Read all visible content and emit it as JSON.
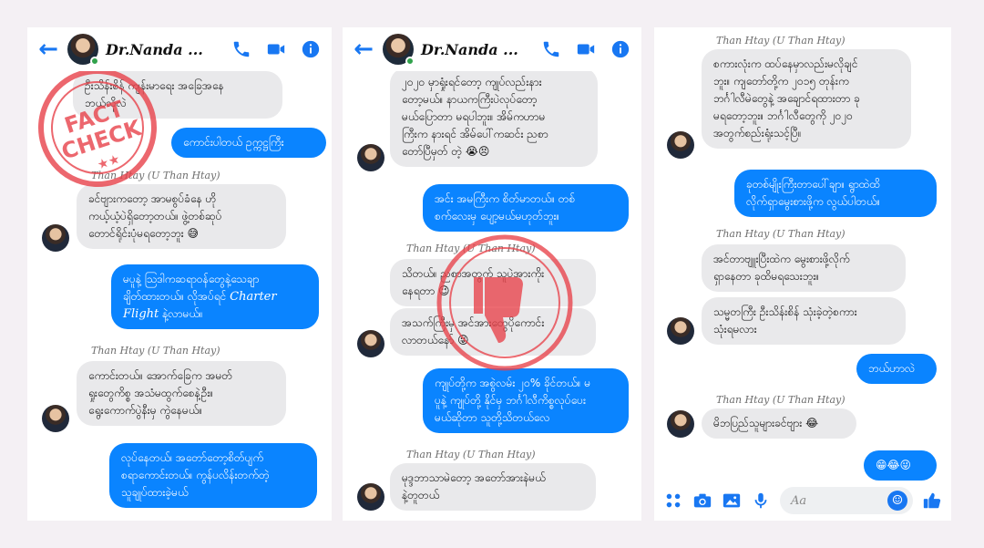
{
  "panel1": {
    "header": {
      "name": "Dr.Nanda ..."
    },
    "m1": "ဦးသိန်းစိန် ကျန်းမာရေး အခြေအနေ\nဘယ်လိုလဲ",
    "m2": "ကောင်းပါတယ် ဥက္ကဋ္ဌကြီး",
    "s1": "Than Htay (U Than Htay)",
    "m3": "ခင်ဗျားကတော့ အာမစွပ်ခံနေ ဟို\nကယ့်ယံ့ပဲရှိတော့တယ်။ ဖွဲ့တစ်ဆုပ်\nတောင်ရိုင်းပုံမရတော့ဘူး 😅",
    "m4a": "မပူနဲ့ ဩဒါကဆရာဝန်တွေနဲ့သေချာ\nချိတ်ထားတယ်။ လိုအပ်ရင် ",
    "m4b": "Charter\nFlight",
    "m4c": " နဲ့လာမယ်။",
    "s2": "Than Htay (U Than Htay)",
    "m5": "ကောင်းတယ်။ အောက်ခြေက အမတ်\nရှုးတွေကိစ္စ အသံမထွက်စေနဲ့ဦး။\nရွေးကောက်ပွဲနီးမှ ကွဲနေမယ်။",
    "m6": "လုပ်နေတယ်၊ အတော်တော့စိတ်ပျက်\nစရာကောင်းတယ်။ ကွန်ပလိန်းတက်တဲ့\nသူချုပ်ထားခဲ့မယ်"
  },
  "panel2": {
    "header": {
      "name": "Dr.Nanda ..."
    },
    "m1": "၂၀၂၀ မှာရှုံးရင်တော့ ကျုပ်လည်းနား\nတော့မယ်။ နာယကကြီးပဲလုပ်တော့\nမယ်ပြောတာ မရပါဘူး။ အိမ်ကဟာမ\nကြီးက နားရင် အိမ်ပေါ်ကဆင်း ညစာ\nတော်ပြီမှတ် တဲ့ 😭😣",
    "m2": "အင်း အမကြီးက စိတ်မာတယ်။ တစ်\nစက်လေးမှ ပျော့မယ်မဟုတ်ဘူး။",
    "s1": "Than Htay (U Than Htay)",
    "m3": "သိတယ်။ ညစာအတွက် သူပဲအားကိုး\nနေရတာ 😉",
    "m4": "အသက်ကြီးမှ အင်အားတွေပိုကောင်း\nလာတယ်နော် 😜",
    "m5": "ကျုပ်တို့က အစွဲလမ်း ၂၀% ခိုင်တယ်။ မ\nပူနဲ့ ကျုပ်တို့ နိုင်မှ ဘင်္ဂါလီကိစ္စလုပ်ပေး\nမယ်ဆိုတာ သူတို့သိတယ်လေ",
    "s2": "Than Htay (U Than Htay)",
    "m6": "မုဒ္ဒဘာသာမဲတော့ အတော်အားနဲမယ်\nနဲ့တူတယ်"
  },
  "panel3": {
    "s1": "Than Htay (U Than Htay)",
    "m1": "စကားလုံးက ထပ်နေမှာလည်းမလိုချင်\nဘူး။ ကျတော်တို့က ၂၀၁၅ တုန်းက\nဘင်္ဂါလီမဲတွေနဲ့ အချောင်ရထားတာ ခု\nမရတော့ဘူး။ ဘင်္ဂါလီတွေကို ၂၀၂၀\nအတွက်စည်းရုံးသင့်ပြီ။",
    "m2": "ခုတစ်မျိုးကြီးတာပေါ်ချာ။ ရွာထဲထိ\nလိုက်ရှာမွေးစားဖို့က လွယ်ပါတယ်။",
    "s2": "Than Htay (U Than Htay)",
    "m3": "အင်တာဗျူးပြီးထဲက မွေးစားဖို့လိုက်\nရှာနေတာ ခုထိမရသေးဘူး။",
    "m4": "သမ္မတကြီး ဦးသိန်းစိန် သုံးခဲ့တဲ့စကား\nသုံးရမလား",
    "m5": "ဘယ်ဟာလဲ",
    "s3": "Than Htay (U Than Htay)",
    "m6": "မိဘပြည်သူများခင်ဗျား 😂",
    "m7": "😁😂😜",
    "composer": {
      "placeholder": "Aa"
    }
  },
  "colors": {
    "accent": "#1877f2",
    "bubble_out": "#0a84ff",
    "bubble_in": "#e9e9eb",
    "stamp": "#e8424a"
  },
  "watermarks": {
    "left_stamp": "FACT CHECK",
    "stars": "★★"
  }
}
